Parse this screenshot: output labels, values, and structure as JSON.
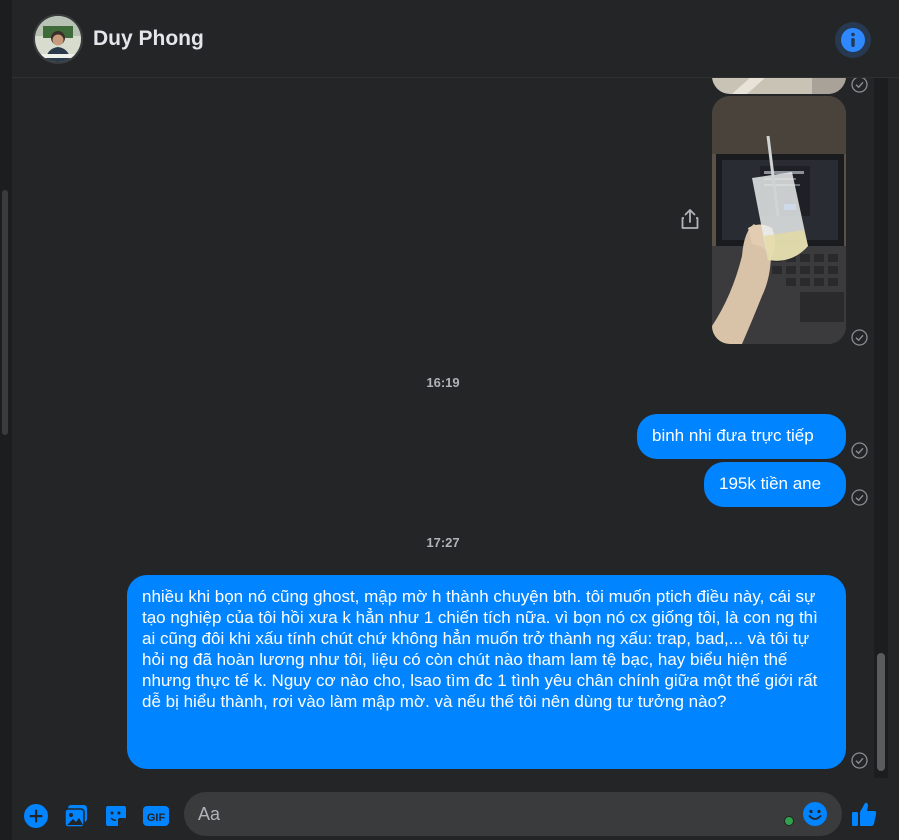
{
  "header": {
    "contact_name": "Duy Phong"
  },
  "icons": {
    "info": "info-icon",
    "share": "share-icon",
    "add": "plus-circle-icon",
    "photo": "photo-icon",
    "sticker": "sticker-icon",
    "gif": "gif-icon",
    "emoji": "emoji-icon",
    "like": "thumbs-up-icon",
    "status": "sent-check-icon"
  },
  "messages": {
    "time_1": "16:19",
    "msg_1": "binh nhi đưa trực tiếp",
    "msg_2": "195k tiền ane",
    "time_2": "17:27",
    "msg_3": "nhiều khi bọn nó cũng ghost, mập mờ  h thành chuyện bth. tôi muốn ptich điều này, cái sự tạo nghiệp của tôi hồi xưa k hẳn như 1 chiến tích nữa. vì bọn nó cx giống tôi, là con ng thì ai cũng đôi khi xấu tính chút chứ không hẳn muốn trở thành ng xấu: trap, bad,... và tôi tự hỏi ng đã hoàn lương như tôi, liệu có còn chút nào tham lam tệ bạc, hay biểu hiện thế nhưng thực tế k. Nguy cơ nào cho, lsao tìm đc 1 tình yêu chân chính giữa một thế giới rất dễ bị  hiểu thành, rơi vào làm mập mờ. và nếu thế tôi nên dùng tư tưởng nào?"
  },
  "composer": {
    "placeholder": "Aa",
    "gif_label": "GIF"
  },
  "colors": {
    "accent": "#0084ff",
    "background": "#242526",
    "input_bg": "#3a3b3c",
    "text": "#e4e6eb",
    "muted": "#b0b3b8",
    "online": "#31a24c"
  }
}
